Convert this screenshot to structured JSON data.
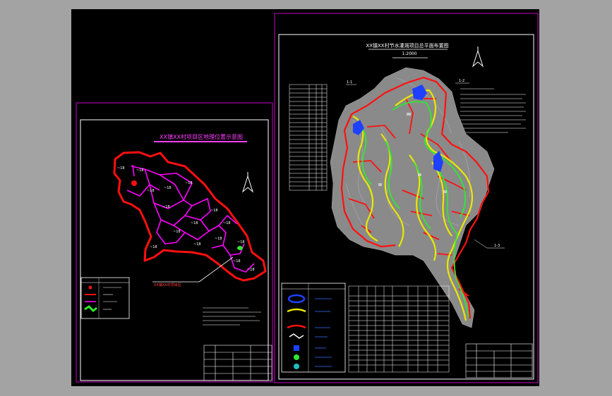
{
  "colors": {
    "paper": "#a3a3a3",
    "canvas": "#000000",
    "frame_magenta": "#c800c8",
    "boundary_red": "#ff1010",
    "village_magenta": "#ff00ff",
    "road_yellow": "#e8e800",
    "canal_green": "#30e830",
    "water_blue": "#2040ff",
    "terrain_grey": "#8a8a8a",
    "text_white": "#ffffff",
    "title_magenta": "#ff40ff"
  },
  "left_sheet": {
    "title": "XX镇XX村项目区地理位置示意图",
    "callout_label": "XX镇XX村项目区"
  },
  "right_sheet": {
    "title": "XX镇XX村节水灌溉项目总平面布置图",
    "scale": "1:2000",
    "label_1": "1-1",
    "label_2": "1-2",
    "label_3": "1-3"
  }
}
